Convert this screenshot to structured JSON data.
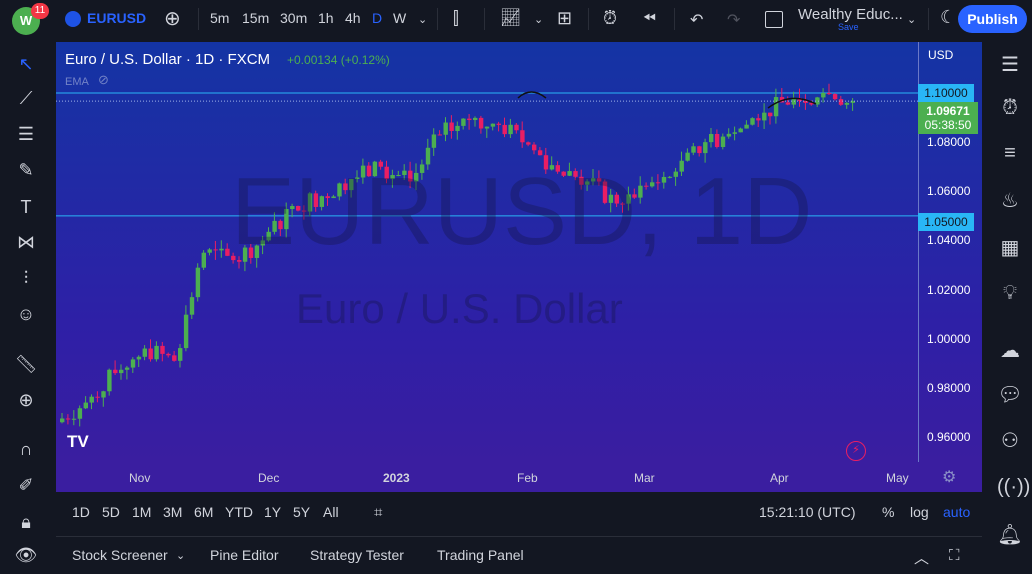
{
  "header": {
    "notifications": "11",
    "symbol": "EURUSD",
    "intervals": [
      "5m",
      "15m",
      "30m",
      "1h",
      "4h",
      "D",
      "W"
    ],
    "active_interval": "D",
    "layout_name": "Wealthy Educ...",
    "save_label": "Save",
    "publish_label": "Publish"
  },
  "legend": {
    "title": "Euro / U.S. Dollar · 1D · FXCM",
    "change": "+0.00134 (+0.12%)",
    "indicator": "EMA"
  },
  "watermark": {
    "symbol": "EURUSD, 1D",
    "name": "Euro / U.S. Dollar"
  },
  "price_axis": {
    "currency": "USD",
    "ticks": [
      "1.08000",
      "1.06000",
      "1.04000",
      "1.02000",
      "1.00000",
      "0.98000",
      "0.96000"
    ],
    "line_upper": "1.10000",
    "line_lower": "1.05000",
    "last_price": "1.09671",
    "countdown": "05:38:50"
  },
  "time_axis": {
    "labels": [
      "Nov",
      "Dec",
      "2023",
      "Feb",
      "Mar",
      "Apr",
      "May"
    ]
  },
  "ranges": [
    "1D",
    "5D",
    "1M",
    "3M",
    "6M",
    "YTD",
    "1Y",
    "5Y",
    "All"
  ],
  "clock": "15:21:10 (UTC)",
  "scale_opts": [
    "%",
    "log",
    "auto"
  ],
  "panel_tabs": [
    "Stock Screener",
    "Pine Editor",
    "Strategy Tester",
    "Trading Panel"
  ],
  "colors": {
    "up": "#4caf50",
    "down": "#e91e63",
    "line": "#29b6f6",
    "accent": "#2962ff"
  },
  "chart_data": {
    "type": "candlestick",
    "weekly_closes": [
      0.974,
      0.986,
      0.996,
      0.991,
      1.035,
      1.032,
      1.04,
      1.054,
      1.058,
      1.065,
      1.07,
      1.064,
      1.083,
      1.089,
      1.087,
      1.079,
      1.068,
      1.064,
      1.055,
      1.062,
      1.068,
      1.08,
      1.084,
      1.092,
      1.098,
      1.1,
      1.0967
    ],
    "start_price": 0.966,
    "ylim": [
      0.95,
      1.11
    ],
    "hlines": [
      1.1,
      1.05
    ]
  }
}
